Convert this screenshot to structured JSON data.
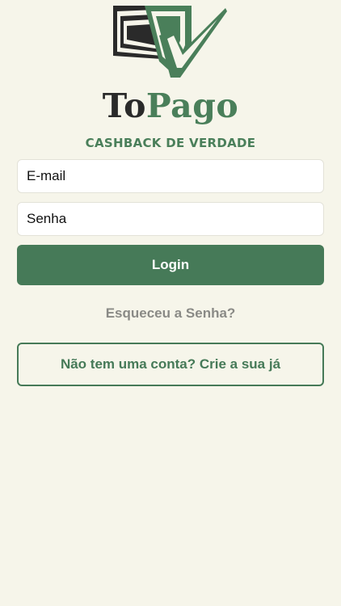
{
  "brand": {
    "name_part1": "To",
    "name_part2": "Pago",
    "tagline": "CASHBACK DE VERDADE",
    "logo_icon": "checkmark-cards-icon",
    "colors": {
      "dark": "#2a2a2a",
      "green": "#4a7f5a"
    }
  },
  "form": {
    "email_placeholder": "E-mail",
    "email_value": "",
    "password_placeholder": "Senha",
    "password_value": "",
    "login_label": "Login",
    "forgot_label": "Esqueceu a Senha?",
    "signup_label": "Não tem uma conta? Crie a sua já"
  },
  "colors": {
    "background": "#f6f5ea",
    "accent": "#467a58",
    "muted_text": "#8a8a86"
  }
}
